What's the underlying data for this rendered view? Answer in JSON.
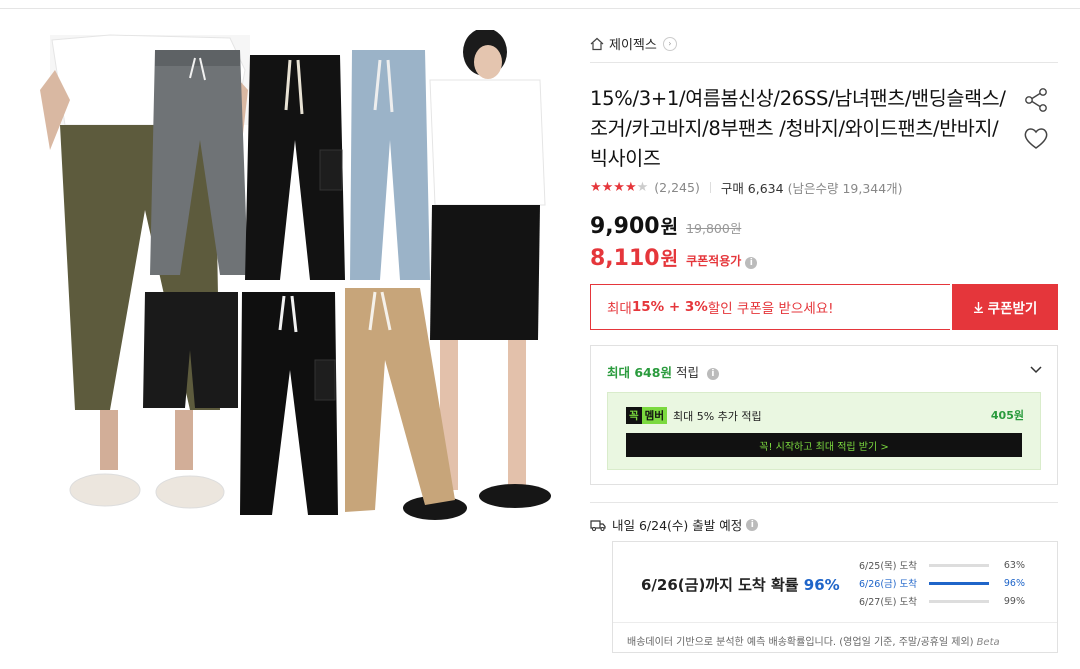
{
  "seller": {
    "name": "제이젝스",
    "icon": "home-icon"
  },
  "product": {
    "title": "15%/3+1/여름봄신상/26SS/남녀팬츠/밴딩슬랙스/조거/카고바지/8부팬츠 /청바지/와이드팬츠/반바지/빅사이즈",
    "rating": 4.5,
    "review_count": "(2,245)",
    "purchase": "구매 6,634",
    "remaining": "(남은수량 19,344개)"
  },
  "price": {
    "sale": "9,900",
    "unit": "원",
    "original": "19,800원",
    "coupon_price": "8,110",
    "coupon_label": "쿠폰적용가"
  },
  "coupon": {
    "text_prefix": "최대 ",
    "text_highlight": "15% + 3%",
    "text_suffix": " 할인 쿠폰을 받으세요!",
    "button_label": "쿠폰받기"
  },
  "points": {
    "prefix": "최대 ",
    "amount": "648",
    "suffix": "원",
    "label": " 적립",
    "member_badge_1": "꼭",
    "member_badge_2": "멤버",
    "member_text": "최대 5% 추가 적립",
    "member_amount": "405원",
    "member_button": "꼭! 시작하고 최대 적립 받기 >"
  },
  "delivery": {
    "text": "내일 6/24(수) 출발 예정",
    "arrival_prefix": "6/26(금)까지 도착 확률 ",
    "arrival_pct": "96%",
    "distribution": [
      {
        "label": "6/25(목) 도착",
        "pct": "63%",
        "value": 63,
        "highlight": false
      },
      {
        "label": "6/26(금) 도착",
        "pct": "96%",
        "value": 96,
        "highlight": true
      },
      {
        "label": "6/27(토) 도착",
        "pct": "99%",
        "value": 99,
        "highlight": false
      }
    ],
    "note": "배송데이터 기반으로 분석한 예측 배송확률입니다. (영업일 기준, 주말/공휴일 제외)",
    "beta": "Beta"
  },
  "colors": {
    "accent_red": "#e5363b",
    "point_green": "#2a9b3d",
    "member_green": "#7bd93f",
    "info_blue": "#1f65c9"
  }
}
